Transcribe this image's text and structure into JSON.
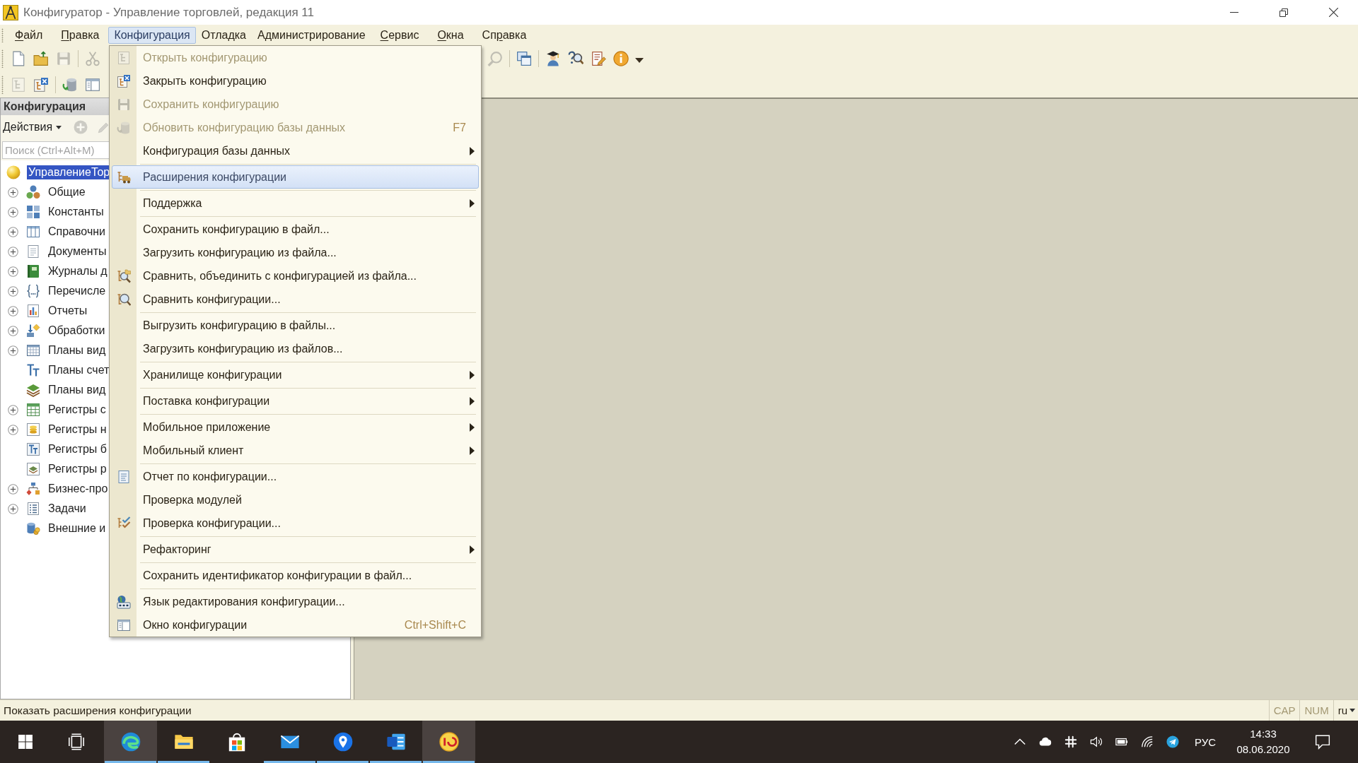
{
  "window": {
    "title": "Конфигуратор - Управление торговлей, редакция 11"
  },
  "menu_bar": [
    {
      "label": [
        {
          "text": "Ф",
          "access_key": true
        },
        {
          "text": "айл",
          "access_key": false
        }
      ],
      "selected": false
    },
    {
      "label": [
        {
          "text": "П",
          "access_key": true
        },
        {
          "text": "равка",
          "access_key": false
        }
      ],
      "selected": false
    },
    {
      "label": [
        {
          "text": "Конфигурация",
          "access_key": false
        }
      ],
      "selected": true
    },
    {
      "label": [
        {
          "text": "Отладка",
          "access_key": false
        }
      ],
      "selected": false
    },
    {
      "label": [
        {
          "text": "Администрирование",
          "access_key": false
        }
      ],
      "selected": false
    },
    {
      "label": [
        {
          "text": "С",
          "access_key": true
        },
        {
          "text": "ервис",
          "access_key": false
        }
      ],
      "selected": false
    },
    {
      "label": [
        {
          "text": "О",
          "access_key": true
        },
        {
          "text": "кна",
          "access_key": false
        }
      ],
      "selected": false
    },
    {
      "label": [
        {
          "text": "Сп",
          "access_key": false
        },
        {
          "text": "р",
          "access_key": true
        },
        {
          "text": "авка",
          "access_key": false
        }
      ],
      "selected": false
    }
  ],
  "toolbar": {
    "rows": [
      {
        "groups": [
          [
            {
              "kind": "button",
              "disabled": false
            },
            {
              "kind": "button",
              "disabled": false
            },
            {
              "kind": "button",
              "disabled": true
            },
            {
              "kind": "separator"
            },
            {
              "kind": "button",
              "disabled": true
            }
          ],
          [
            {
              "kind": "button",
              "disabled": true
            },
            {
              "kind": "separator"
            },
            {
              "kind": "button",
              "disabled": false
            },
            {
              "kind": "separator"
            },
            {
              "kind": "button",
              "disabled": false
            },
            {
              "kind": "button",
              "disabled": false
            },
            {
              "kind": "button",
              "disabled": false
            },
            {
              "kind": "button",
              "disabled": false
            },
            {
              "kind": "dropdown"
            }
          ]
        ]
      },
      {
        "groups": [
          [
            {
              "kind": "button",
              "disabled": true
            },
            {
              "kind": "button",
              "disabled": false
            },
            {
              "kind": "separator"
            },
            {
              "kind": "button",
              "disabled": false
            },
            {
              "kind": "button",
              "disabled": false
            }
          ]
        ]
      }
    ]
  },
  "config_panel": {
    "title": "Конфигурация",
    "actions": {
      "label": "Действия",
      "tools": [
        {
          "disabled": true
        },
        {
          "disabled": true
        }
      ]
    },
    "search": {
      "placeholder": "Поиск (Ctrl+Alt+M)"
    },
    "tree": [
      {
        "label": "УправлениеТор",
        "selected": true,
        "children": [
          {
            "label": "Общие",
            "selected": false,
            "expandable": true,
            "expanded": false
          },
          {
            "label": "Константы",
            "selected": false,
            "expandable": true,
            "expanded": false
          },
          {
            "label": "Справочни",
            "selected": false,
            "expandable": true,
            "expanded": false
          },
          {
            "label": "Документы",
            "selected": false,
            "expandable": true,
            "expanded": false
          },
          {
            "label": "Журналы д",
            "selected": false,
            "expandable": true,
            "expanded": false
          },
          {
            "label": "Перечисле",
            "selected": false,
            "expandable": true,
            "expanded": false
          },
          {
            "label": "Отчеты",
            "selected": false,
            "expandable": true,
            "expanded": false
          },
          {
            "label": "Обработки",
            "selected": false,
            "expandable": true,
            "expanded": false
          },
          {
            "label": "Планы вид",
            "selected": false,
            "expandable": true,
            "expanded": false
          },
          {
            "label": "Планы счет",
            "selected": false,
            "expandable": false,
            "expanded": false
          },
          {
            "label": "Планы вид",
            "selected": false,
            "expandable": false,
            "expanded": false
          },
          {
            "label": "Регистры с",
            "selected": false,
            "expandable": true,
            "expanded": false
          },
          {
            "label": "Регистры н",
            "selected": false,
            "expandable": true,
            "expanded": false
          },
          {
            "label": "Регистры б",
            "selected": false,
            "expandable": false,
            "expanded": false
          },
          {
            "label": "Регистры р",
            "selected": false,
            "expandable": false,
            "expanded": false
          },
          {
            "label": "Бизнес-про",
            "selected": false,
            "expandable": true,
            "expanded": false
          },
          {
            "label": "Задачи",
            "selected": false,
            "expandable": true,
            "expanded": false
          },
          {
            "label": "Внешние и",
            "selected": false,
            "expandable": false,
            "expanded": false
          }
        ]
      }
    ]
  },
  "config_menu": {
    "items": [
      {
        "kind": "item",
        "label": "Открыть конфигурацию",
        "disabled": true,
        "selected": false,
        "submenu": false
      },
      {
        "kind": "item",
        "label": "Закрыть конфигурацию",
        "disabled": false,
        "selected": false,
        "submenu": false
      },
      {
        "kind": "item",
        "label": "Сохранить конфигурацию",
        "disabled": true,
        "selected": false,
        "submenu": false
      },
      {
        "kind": "item",
        "label": "Обновить конфигурацию базы данных",
        "shortcut": "F7",
        "disabled": true,
        "selected": false,
        "submenu": false
      },
      {
        "kind": "item",
        "label": "Конфигурация базы данных",
        "disabled": false,
        "selected": false,
        "submenu": true
      },
      {
        "kind": "separator"
      },
      {
        "kind": "item",
        "label": "Расширения конфигурации",
        "disabled": false,
        "selected": true,
        "submenu": false
      },
      {
        "kind": "separator"
      },
      {
        "kind": "item",
        "label": "Поддержка",
        "disabled": false,
        "selected": false,
        "submenu": true
      },
      {
        "kind": "separator"
      },
      {
        "kind": "item",
        "label": "Сохранить конфигурацию в файл...",
        "disabled": false,
        "selected": false,
        "submenu": false
      },
      {
        "kind": "item",
        "label": "Загрузить конфигурацию из файла...",
        "disabled": false,
        "selected": false,
        "submenu": false
      },
      {
        "kind": "item",
        "label": "Сравнить, объединить с конфигурацией из файла...",
        "disabled": false,
        "selected": false,
        "submenu": false
      },
      {
        "kind": "item",
        "label": "Сравнить конфигурации...",
        "disabled": false,
        "selected": false,
        "submenu": false
      },
      {
        "kind": "separator"
      },
      {
        "kind": "item",
        "label": "Выгрузить конфигурацию в файлы...",
        "disabled": false,
        "selected": false,
        "submenu": false
      },
      {
        "kind": "item",
        "label": "Загрузить конфигурацию из файлов...",
        "disabled": false,
        "selected": false,
        "submenu": false
      },
      {
        "kind": "separator"
      },
      {
        "kind": "item",
        "label": "Хранилище конфигурации",
        "disabled": false,
        "selected": false,
        "submenu": true
      },
      {
        "kind": "separator"
      },
      {
        "kind": "item",
        "label": "Поставка конфигурации",
        "disabled": false,
        "selected": false,
        "submenu": true
      },
      {
        "kind": "separator"
      },
      {
        "kind": "item",
        "label": "Мобильное приложение",
        "disabled": false,
        "selected": false,
        "submenu": true
      },
      {
        "kind": "item",
        "label": "Мобильный клиент",
        "disabled": false,
        "selected": false,
        "submenu": true
      },
      {
        "kind": "separator"
      },
      {
        "kind": "item",
        "label": "Отчет по конфигурации...",
        "disabled": false,
        "selected": false,
        "submenu": false
      },
      {
        "kind": "item",
        "label": "Проверка модулей",
        "disabled": false,
        "selected": false,
        "submenu": false
      },
      {
        "kind": "item",
        "label": "Проверка конфигурации...",
        "disabled": false,
        "selected": false,
        "submenu": false
      },
      {
        "kind": "separator"
      },
      {
        "kind": "item",
        "label": "Рефакторинг",
        "disabled": false,
        "selected": false,
        "submenu": true
      },
      {
        "kind": "separator"
      },
      {
        "kind": "item",
        "label": "Сохранить идентификатор конфигурации в файл...",
        "disabled": false,
        "selected": false,
        "submenu": false
      },
      {
        "kind": "separator"
      },
      {
        "kind": "item",
        "label": "Язык редактирования конфигурации...",
        "disabled": false,
        "selected": false,
        "submenu": false
      },
      {
        "kind": "item",
        "label": "Окно конфигурации",
        "shortcut": "Ctrl+Shift+C",
        "disabled": false,
        "selected": false,
        "submenu": false
      }
    ]
  },
  "status_bar": {
    "text": "Показать расширения конфигурации",
    "indicators": [
      {
        "label": "CAP",
        "on": false
      },
      {
        "label": "NUM",
        "on": false
      }
    ],
    "language": "ru"
  },
  "taskbar": {
    "apps": [
      {
        "highlighted": true,
        "running": true
      },
      {
        "highlighted": false,
        "running": true
      },
      {
        "highlighted": false,
        "running": false
      },
      {
        "highlighted": false,
        "running": true
      },
      {
        "highlighted": false,
        "running": true
      },
      {
        "highlighted": false,
        "running": true
      },
      {
        "highlighted": true,
        "running": true
      }
    ],
    "tray": {
      "language": "РУС",
      "time": "14:33",
      "date": "08.06.2020"
    }
  }
}
